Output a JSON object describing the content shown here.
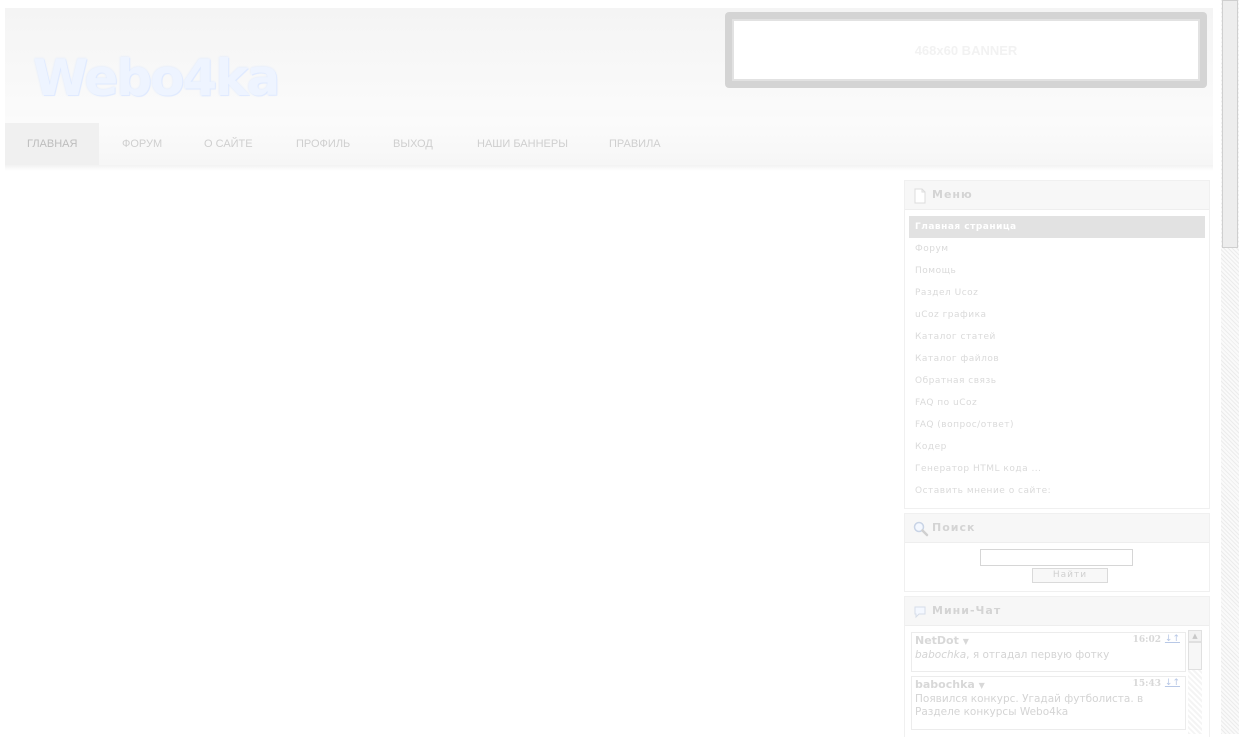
{
  "header": {
    "logo_text": "Webo4ka",
    "banner_text": "468x60 BANNER"
  },
  "nav": {
    "items": [
      {
        "label": "ГЛАВНАЯ"
      },
      {
        "label": "ФОРУМ"
      },
      {
        "label": "О САЙТЕ"
      },
      {
        "label": "ПРОФИЛЬ"
      },
      {
        "label": "ВЫХОД"
      },
      {
        "label": "НАШИ БАННЕРЫ"
      },
      {
        "label": "ПРАВИЛА"
      }
    ]
  },
  "sidebar": {
    "menu": {
      "title": "Меню",
      "items": [
        {
          "label": "Главная страница"
        },
        {
          "label": "Форум"
        },
        {
          "label": "Помощь"
        },
        {
          "label": "Раздел Ucoz"
        },
        {
          "label": "uCoz графика"
        },
        {
          "label": "Каталог статей"
        },
        {
          "label": "Каталог файлов"
        },
        {
          "label": "Обратная связь"
        },
        {
          "label": "FAQ по uCoz"
        },
        {
          "label": "FAQ (вопрос/ответ)"
        },
        {
          "label": "Кодер"
        },
        {
          "label": "Генератор HTML кода ..."
        },
        {
          "label": "Оставить мнение о сайте:"
        }
      ]
    },
    "search": {
      "title": "Поиск",
      "input_value": "",
      "button_label": "Найти"
    },
    "chat": {
      "title": "Мини-Чат",
      "messages": [
        {
          "user": "NetDot",
          "time": "16:02",
          "arrows": "↓↑",
          "mention": "babochka",
          "text": ", я отгадал первую фотку"
        },
        {
          "user": "babochka",
          "time": "15:43",
          "arrows": "↓↑",
          "text": "Появился конкурс. Угадай футболиста. в Разделе конкурсы Webo4ka"
        }
      ]
    }
  },
  "colors": {
    "menu_active_bg": "#e2e2e2",
    "text_faint": "#d4d4d4"
  }
}
